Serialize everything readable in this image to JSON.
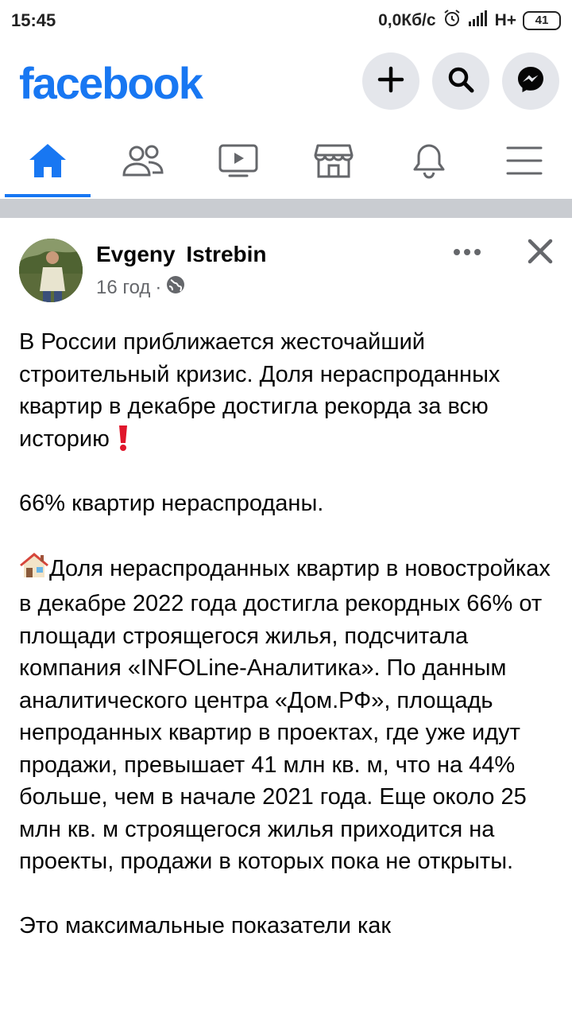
{
  "status_bar": {
    "time": "15:45",
    "network_speed": "0,0Кб/с",
    "network_type": "H+",
    "battery": "41"
  },
  "header": {
    "logo": "facebook",
    "icons": [
      "plus-icon",
      "search-icon",
      "messenger-icon"
    ]
  },
  "nav": {
    "items": [
      "home-icon",
      "friends-icon",
      "video-icon",
      "marketplace-icon",
      "notifications-icon",
      "menu-icon"
    ],
    "active_index": 0
  },
  "post": {
    "author": "Evgeny  Istrebin",
    "time": "16 год",
    "separator": "·",
    "paragraphs": [
      "В России приближается жесточайший строительный кризис.  Доля нераспроданных квартир в декабре достигла рекорда за всю историю",
      "66% квартир нераспроданы.",
      "Доля нераспроданных квартир в новостройках в декабре 2022 года достигла рекордных 66% от площади строящегося жилья, подсчитала компания «INFOLine-Аналитика». По данным аналитического центра «Дом.РФ», площадь непроданных квартир в проектах, где уже идут продажи, превышает 41 млн кв. м, что на 44% больше, чем в начале 2021 года. Еще около 25 млн кв. м строящегося жилья приходится на проекты, продажи в которых пока не открыты.",
      "Это максимальные показатели как"
    ],
    "emoji": [
      "exclamation-icon",
      "house-icon"
    ]
  },
  "colors": {
    "brand": "#1877f2",
    "icon_gray": "#65676b",
    "button_bg": "#e4e6eb",
    "divider": "#c9ccd1",
    "exclamation": "#e0162b"
  }
}
